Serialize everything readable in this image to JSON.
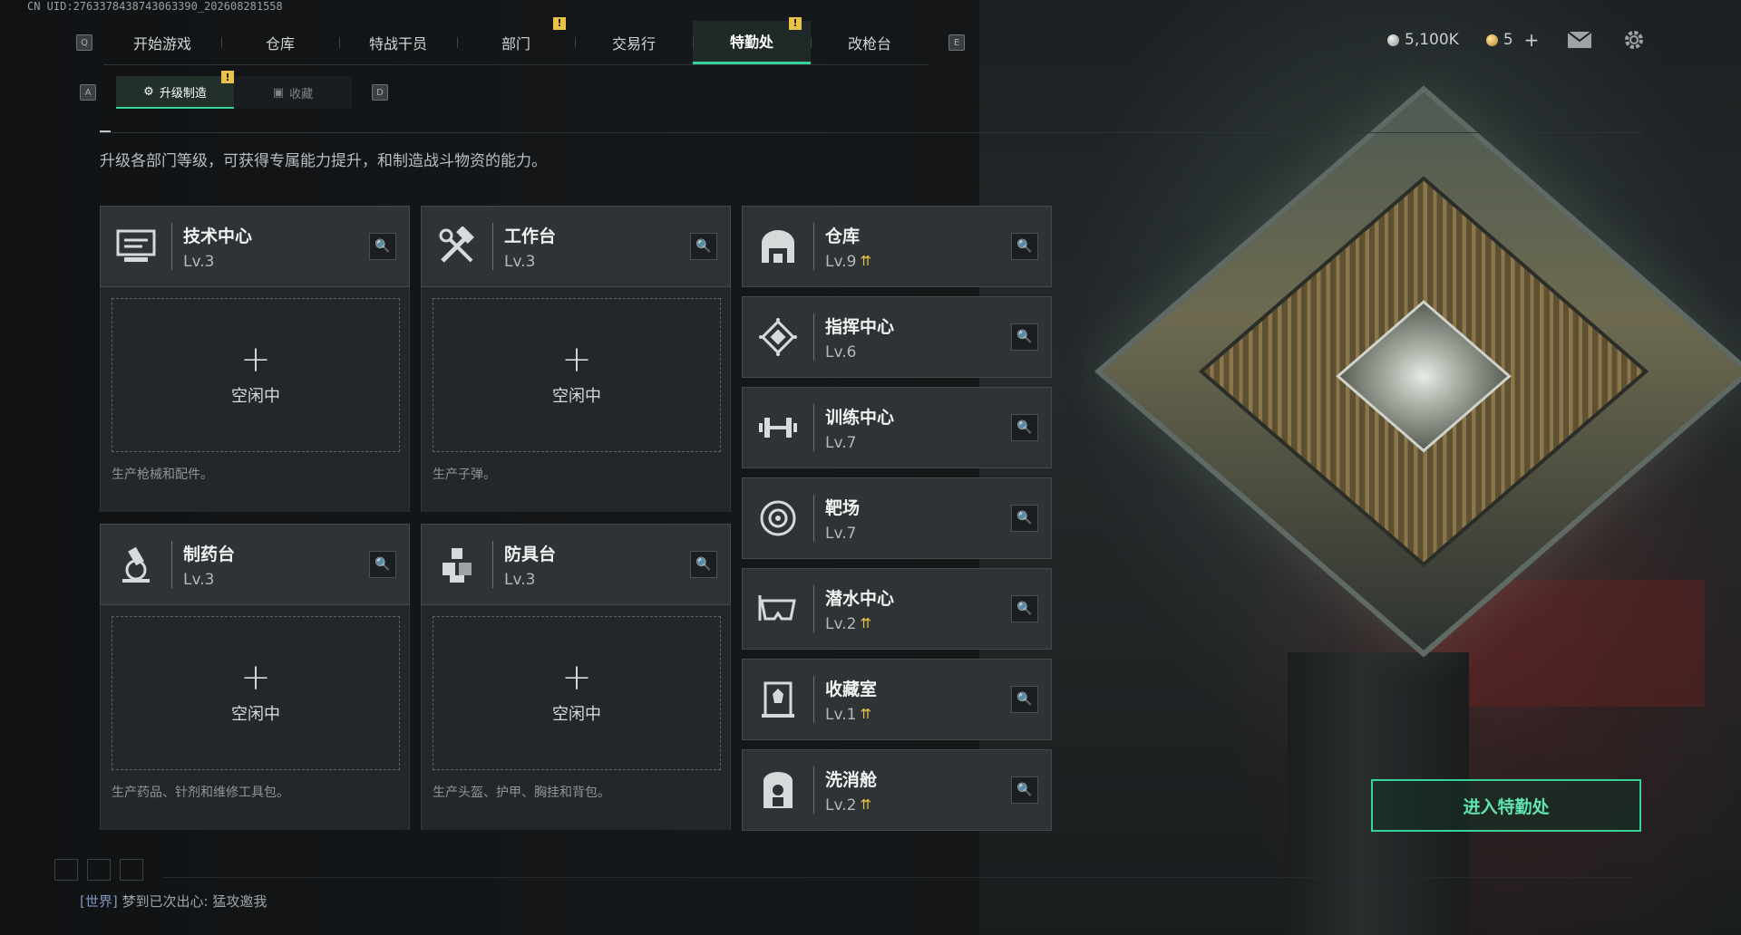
{
  "uid_text": "CN UID:2763378438743063390_202608281558",
  "nav": {
    "left_key": "Q",
    "right_key": "E",
    "tabs": [
      {
        "label": "开始游戏",
        "active": false,
        "alert": false
      },
      {
        "label": "仓库",
        "active": false,
        "alert": false
      },
      {
        "label": "特战干员",
        "active": false,
        "alert": false
      },
      {
        "label": "部门",
        "active": false,
        "alert": true
      },
      {
        "label": "交易行",
        "active": false,
        "alert": false
      },
      {
        "label": "特勤处",
        "active": true,
        "alert": true
      },
      {
        "label": "改枪台",
        "active": false,
        "alert": false
      }
    ],
    "alert_mark": "!"
  },
  "currency": {
    "silver": "5,100K",
    "gold": "5",
    "plus": "+"
  },
  "icons": {
    "mail": "mail-icon",
    "settings": "gear-icon"
  },
  "subnav": {
    "left_key": "A",
    "right_key": "D",
    "tabs": [
      {
        "label": "升级制造",
        "active": true,
        "alert": true
      },
      {
        "label": "收藏",
        "active": false,
        "alert": false
      }
    ]
  },
  "description": "升级各部门等级，可获得专属能力提升，和制造战斗物资的能力。",
  "production": [
    {
      "name": "技术中心",
      "level": "Lv.3",
      "status": "空闲中",
      "hint": "生产枪械和配件。",
      "icon": "tech-center-icon"
    },
    {
      "name": "工作台",
      "level": "Lv.3",
      "status": "空闲中",
      "hint": "生产子弹。",
      "icon": "workbench-icon"
    },
    {
      "name": "制药台",
      "level": "Lv.3",
      "status": "空闲中",
      "hint": "生产药品、针剂和维修工具包。",
      "icon": "pharmacy-icon"
    },
    {
      "name": "防具台",
      "level": "Lv.3",
      "status": "空闲中",
      "hint": "生产头盔、护甲、胸挂和背包。",
      "icon": "armor-icon"
    }
  ],
  "facilities": [
    {
      "name": "仓库",
      "level": "Lv.9",
      "upgradable": true,
      "icon": "warehouse-icon"
    },
    {
      "name": "指挥中心",
      "level": "Lv.6",
      "upgradable": false,
      "icon": "command-center-icon"
    },
    {
      "name": "训练中心",
      "level": "Lv.7",
      "upgradable": false,
      "icon": "dumbbell-icon"
    },
    {
      "name": "靶场",
      "level": "Lv.7",
      "upgradable": false,
      "icon": "target-icon"
    },
    {
      "name": "潜水中心",
      "level": "Lv.2",
      "upgradable": true,
      "icon": "diving-mask-icon"
    },
    {
      "name": "收藏室",
      "level": "Lv.1",
      "upgradable": true,
      "icon": "collection-icon"
    },
    {
      "name": "洗消舱",
      "level": "Lv.2",
      "upgradable": true,
      "icon": "decon-pod-icon"
    }
  ],
  "enter_button": "进入特勤处",
  "chat": {
    "channel": "[世界]",
    "message": "梦到已次出心: 猛攻邀我"
  },
  "colors": {
    "accent": "#37d29a",
    "alert": "#e9c24a",
    "upgrade": "#e6c04a"
  }
}
